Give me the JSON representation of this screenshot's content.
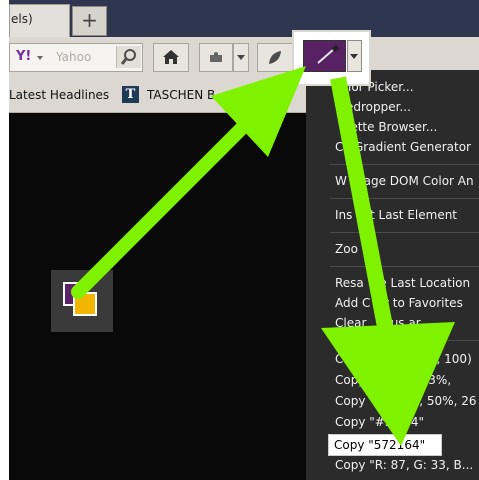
{
  "tabs": {
    "active_title": "els)",
    "new_tab_symbol": "+"
  },
  "toolbar": {
    "search_logo": "Y!",
    "search_placeholder": "Yahoo",
    "search_icon": "magnifier-icon",
    "home_icon": "home-icon",
    "addon_icon": "puzzle-icon",
    "leaf_icon": "leaf-icon"
  },
  "bookmarks": {
    "items": [
      {
        "label": "Latest Headlines",
        "icon": "rss-icon"
      },
      {
        "label": "TASCHEN B",
        "icon": "taschen-logo"
      }
    ],
    "logo_letter": "T"
  },
  "colorzilla": {
    "current_color": "#572164",
    "icon": "eyedropper-icon"
  },
  "menu": {
    "items": [
      "Color Picker...",
      "Eyedropper...",
      "Palette Browser...",
      "CSS Gradient Generator",
      "Webpage DOM Color Analyzer",
      "Inspect Last Element",
      "Zoom",
      "Resample Last Location",
      "Add Color to Favorites",
      "Clear Status Bar",
      "Copy \"rgb(87, 33, 100)\"",
      "Copy \"hsl(288, 50%, 26%)\"",
      "Copy \"#572164\"",
      "Copy \"R: 87, G: 33, B..."
    ],
    "visible_fragments": [
      "lor Picker...",
      "edropper...",
      "lette Browser...",
      "C",
      "Gradient Generator",
      "W",
      "page DOM Color An",
      "Ins",
      "t Last Element",
      "Zoo",
      "Resa",
      "le Last Location",
      "Add C",
      "r to Favorites",
      "Clear",
      "tus ar",
      "Copy",
      "7, 33, 100)",
      "4%, 13%,",
      "Copy \"h",
      "88, 50%, 26",
      "Copy \"#5",
      "2164\"",
      "Copy \"572164\"",
      "Copy \"R: 87, G: 33, B..."
    ],
    "highlighted": "Copy \"572164\"",
    "copy_44_label": "Copy"
  },
  "colors": {
    "arrow": "#7ff200",
    "picked": "#572164",
    "swatch_yellow": "#f2b500"
  }
}
